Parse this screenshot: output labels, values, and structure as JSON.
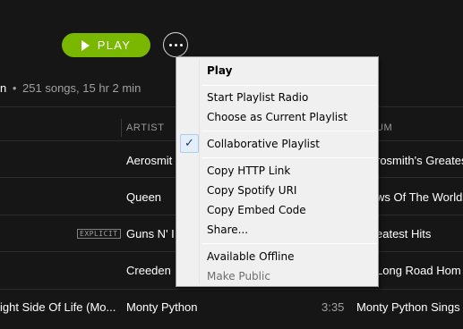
{
  "header": {
    "play_label": "PLAY",
    "more_icon": "ellipsis-icon"
  },
  "playlist_meta": {
    "owner_fragment": "n",
    "separator": "•",
    "summary": "251 songs, 15 hr 2 min"
  },
  "columns": {
    "artist": "ARTIST",
    "album_fragment": "UM"
  },
  "rows": [
    {
      "artist": "Aerosmit",
      "album": "rosmith's Greates"
    },
    {
      "artist": "Queen",
      "album": "ws Of The World"
    },
    {
      "artist": "Guns N' I",
      "album": "eatest Hits",
      "explicit": "EXPLICIT"
    },
    {
      "artist": "Creeden",
      "album": "Long Road Hom"
    },
    {
      "title": "ight Side Of Life (Mo...",
      "artist": "Monty Python",
      "duration": "3:35",
      "album": "Monty Python Sings"
    }
  ],
  "context_menu": {
    "play": "Play",
    "start_radio": "Start Playlist Radio",
    "choose_current": "Choose as Current Playlist",
    "collaborative": "Collaborative Playlist",
    "check_mark": "✓",
    "copy_http": "Copy HTTP Link",
    "copy_uri": "Copy Spotify URI",
    "copy_embed": "Copy Embed Code",
    "share": "Share...",
    "available_offline": "Available Offline",
    "make_public": "Make Public"
  },
  "colors": {
    "background": "#161616",
    "play_button": "#7ab800",
    "menu_background": "#f0f0f0"
  }
}
